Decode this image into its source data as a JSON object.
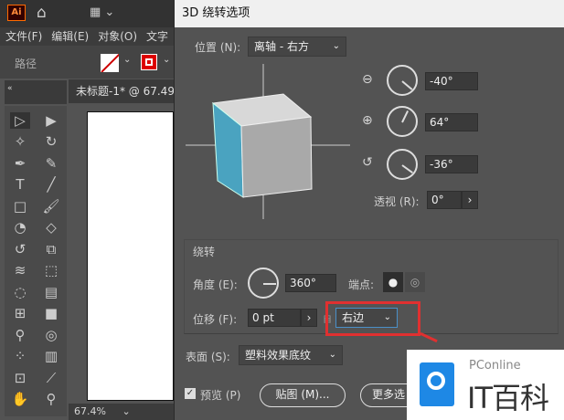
{
  "app": {
    "logo": "Ai",
    "menu": [
      "文件(F)",
      "编辑(E)",
      "对象(O)",
      "文字"
    ],
    "control_label": "路径",
    "doc_tab": "未标题-1* @ 67.49",
    "zoom": "67.4%"
  },
  "dialog": {
    "title": "3D 绕转选项",
    "position_label": "位置 (N):",
    "position_value": "离轴 - 右方",
    "rot_x": "-40°",
    "rot_y": "64°",
    "rot_z": "-36°",
    "perspective_label": "透视 (R):",
    "perspective_value": "0°",
    "revolve_group": "绕转",
    "angle_label": "角度 (E):",
    "angle_value": "360°",
    "cap_label": "端点:",
    "offset_label": "位移 (F):",
    "offset_value": "0 pt",
    "offset_from_value": "右边",
    "surface_label": "表面 (S):",
    "surface_value": "塑料效果底纹",
    "preview_label": "预览 (P)",
    "map_button": "贴图 (M)...",
    "more_button": "更多选"
  },
  "watermark": {
    "brand": "PConline",
    "name": "IT百科"
  },
  "colors": {
    "cube_side": "#4aa3c0",
    "highlight": "#e03030",
    "accent": "#1e88e5"
  }
}
